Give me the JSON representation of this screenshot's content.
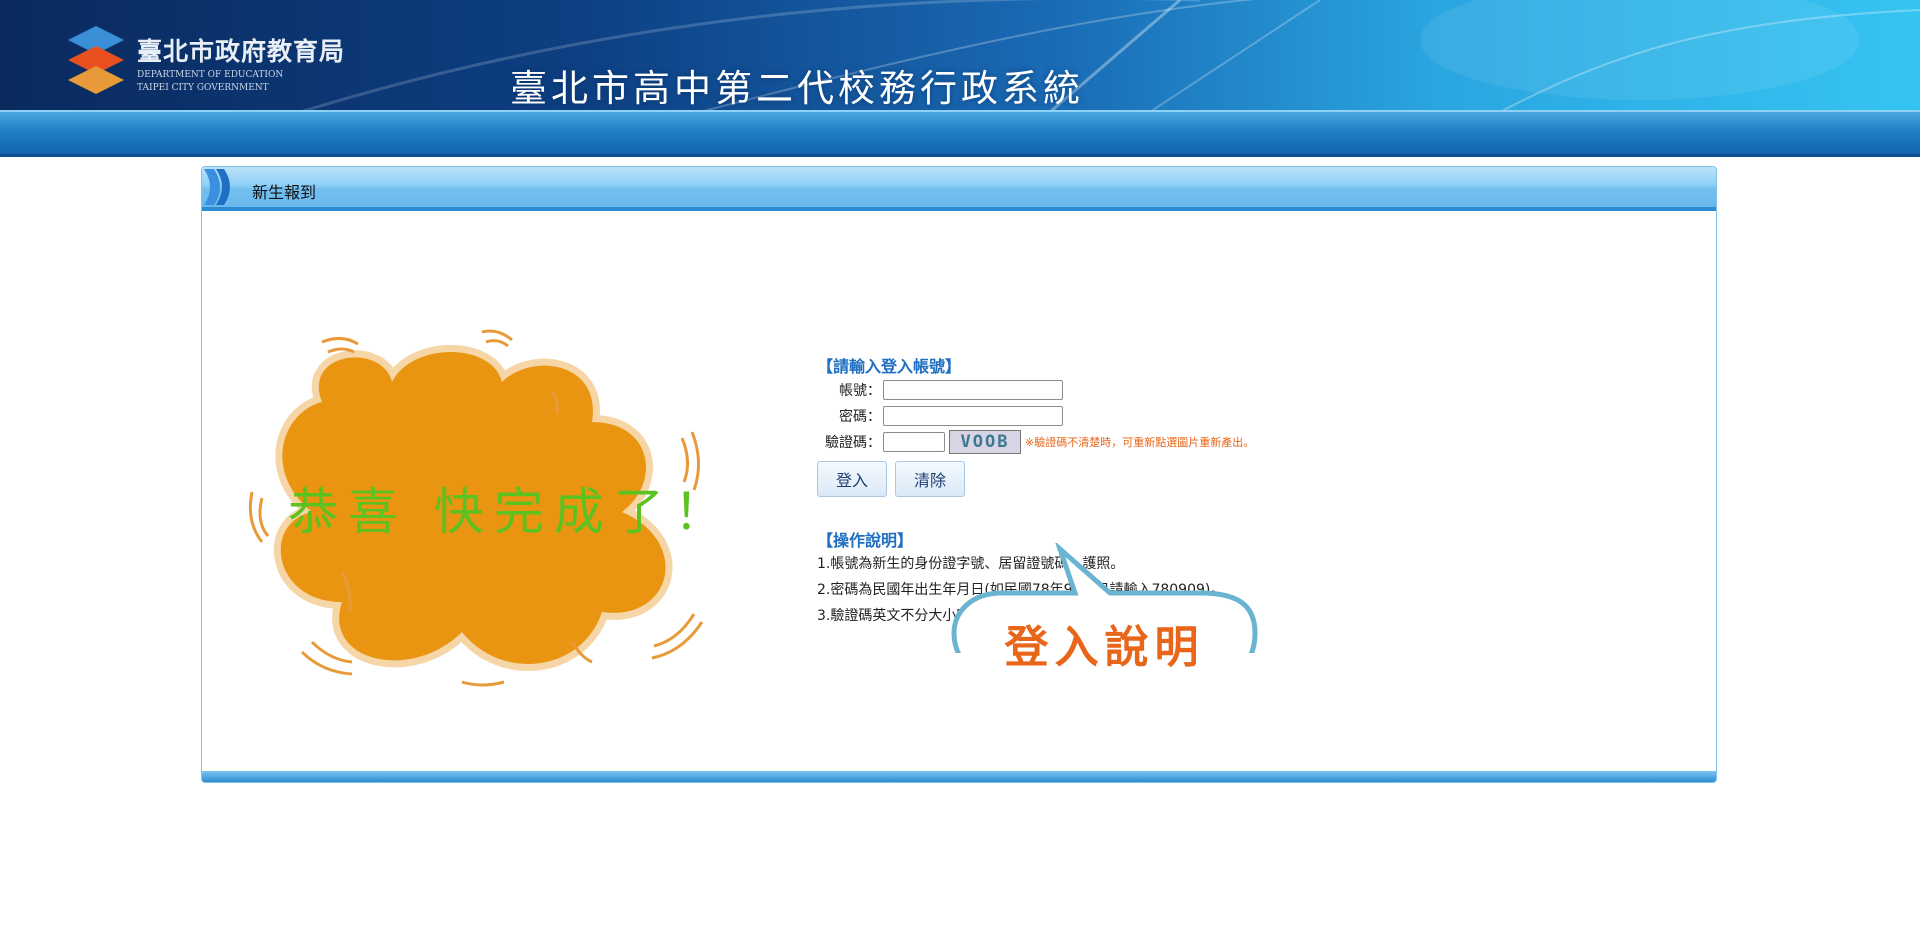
{
  "header": {
    "logo_zh": "臺北市政府教育局",
    "logo_en_line1": "DEPARTMENT OF EDUCATION",
    "logo_en_line2": "TAIPEI CITY GOVERNMENT",
    "system_title": "臺北市高中第二代校務行政系統"
  },
  "panel": {
    "title": "新生報到",
    "congrats_text": "恭喜 快完成了！"
  },
  "login": {
    "section_title": "【請輸入登入帳號】",
    "account_label": "帳號：",
    "account_value": "",
    "password_label": "密碼：",
    "password_value": "",
    "captcha_label": "驗證碼：",
    "captcha_value": "",
    "captcha_image_text": "VOOB",
    "captcha_note": "※驗證碼不清楚時，可重新點選圖片重新產出。",
    "login_button": "登入",
    "clear_button": "清除"
  },
  "instructions": {
    "section_title": "【操作說明】",
    "lines": [
      "1.帳號為新生的身份證字號、居留證號碼、護照。",
      "2.密碼為民國年出生年月日(如民國78年9月9日請輸入780909)。",
      "3.驗證碼英文不分大小寫。"
    ],
    "callout": "登入說明"
  },
  "colors": {
    "accent_blue": "#1f6fc2",
    "orange": "#e8651a",
    "splash_orange": "#ea9512",
    "congrats_green": "#5cc21f",
    "bubble_border": "#6ab4d2"
  }
}
